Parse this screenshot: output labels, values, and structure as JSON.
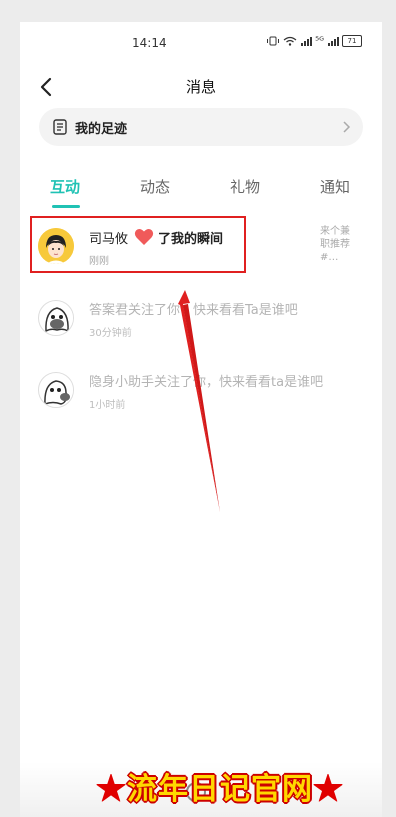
{
  "status": {
    "time": "14:14",
    "network": "⁵ᴳ",
    "battery": "71"
  },
  "nav": {
    "title": "消息"
  },
  "footprint": {
    "label": "我的足迹"
  },
  "tabs": [
    {
      "label": "互动",
      "active": true
    },
    {
      "label": "动态",
      "active": false
    },
    {
      "label": "礼物",
      "active": false
    },
    {
      "label": "通知",
      "active": false
    }
  ],
  "messages": [
    {
      "name": "司马攸",
      "action": "了我的瞬间",
      "time": "刚刚"
    },
    {
      "text": "答案君关注了你，快来看看Ta是谁吧",
      "time": "30分钟前"
    },
    {
      "text": "隐身小助手关注了你，快来看看ta是谁吧",
      "time": "1小时前"
    }
  ],
  "side_snippet": [
    "来个兼",
    "职推荐",
    "#…"
  ],
  "watermark": {
    "star": "★",
    "text": "流年日记官网"
  },
  "colors": {
    "accent": "#20c2b4",
    "heart": "#f05a5a",
    "highlight": "#e02020"
  }
}
